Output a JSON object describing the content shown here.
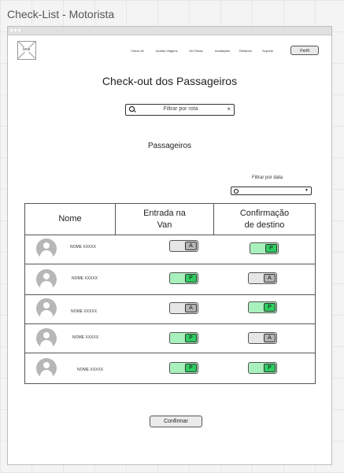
{
  "app_title": "Check-List - Motorista",
  "logo": {
    "label": "Iesb"
  },
  "nav": {
    "items": [
      "Check-IN",
      "Avaliar Viagens",
      "Ver Rotas",
      "Avaliações",
      "Relatório",
      "Suporte"
    ],
    "profile_label": "Perfil"
  },
  "page": {
    "heading": "Check-out dos Passageiros",
    "search": {
      "placeholder": "Filtrar por rota",
      "clear_icon": "×"
    },
    "section_label": "Passageiros",
    "date_filter": {
      "label": "Filtrar por data",
      "value": ""
    }
  },
  "table": {
    "headers": [
      "Nome",
      "Entrada na\nVan",
      "Confirmação\nde destino"
    ],
    "rows": [
      {
        "name": "NOME XXXXX",
        "entrada": "A",
        "confirmacao": "P"
      },
      {
        "name": "NOME XXXXX",
        "entrada": "P",
        "confirmacao": "A"
      },
      {
        "name": "NOME XXXXX",
        "entrada": "A",
        "confirmacao": "P"
      },
      {
        "name": "NOME XXXXX",
        "entrada": "P",
        "confirmacao": "A"
      },
      {
        "name": "NOME XXXXX",
        "entrada": "P",
        "confirmacao": "P"
      }
    ]
  },
  "confirm_button": "Confirmar",
  "colors": {
    "present": "#2ecc61",
    "present_track": "#a8f0bc",
    "absent": "#b3b3b3",
    "absent_track": "#e6e6e6"
  },
  "icons": [
    "search-icon",
    "clear-icon",
    "chevron-down-icon",
    "avatar-icon",
    "logo-placeholder-icon"
  ]
}
